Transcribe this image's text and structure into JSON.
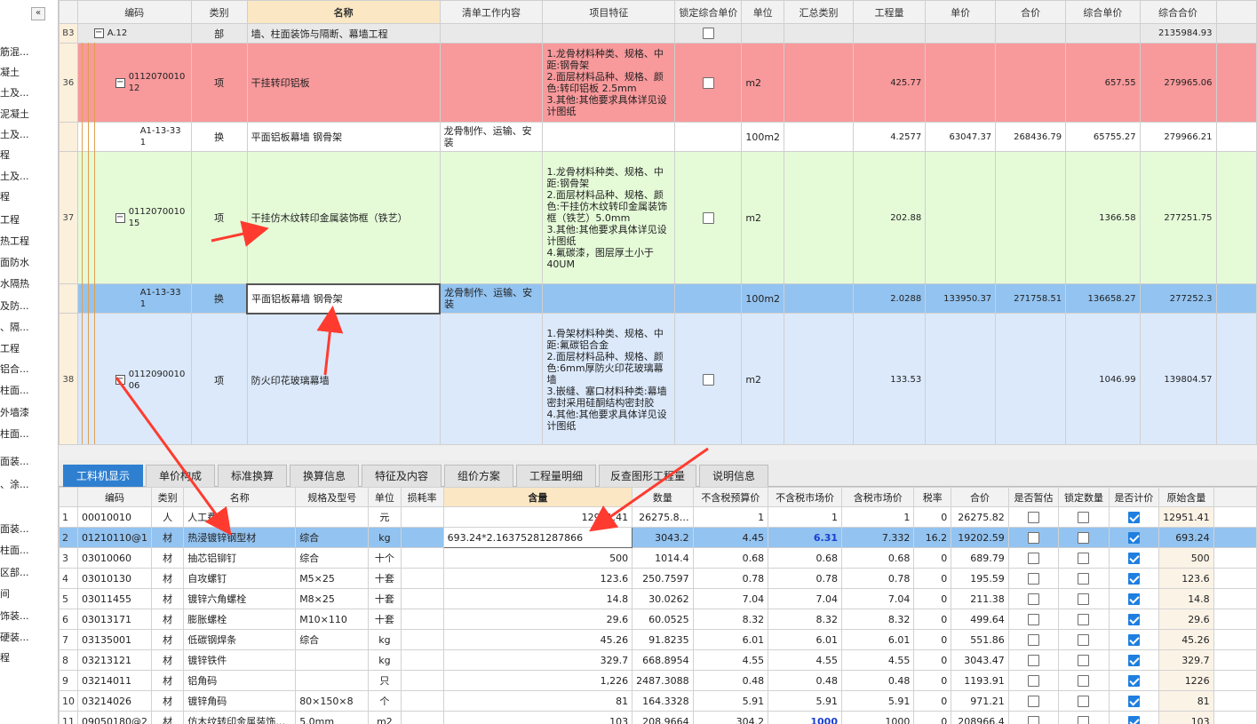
{
  "sidebar": {
    "collapse_label": "«",
    "items": [
      "筋混...",
      "凝土",
      "土及...",
      "泥凝土",
      "土及...",
      "程",
      "土及...",
      "程",
      "工程",
      "热工程",
      "面防水",
      "水隔热",
      "及防...",
      "、隔...",
      "工程",
      "铝合...",
      "柱面...",
      "外墙漆",
      "柱面...",
      "",
      "面装...",
      "、涂...",
      "",
      "面装...",
      "柱面...",
      "区部...",
      "间",
      "饰装...",
      "硬装...",
      "程"
    ]
  },
  "upper": {
    "headers": [
      "编码",
      "类别",
      "名称",
      "清单工作内容",
      "项目特征",
      "锁定综合单价",
      "单位",
      "汇总类别",
      "工程量",
      "单价",
      "合价",
      "综合单价",
      "综合合价"
    ],
    "rows": [
      {
        "idx": "B3",
        "code": "A.12",
        "type": "部",
        "name": "墙、柱面装饰与隔断、幕墙工程",
        "work": "",
        "feature": "",
        "unit": "",
        "qty": "",
        "price": "",
        "total": "",
        "uprice": "",
        "utotal": "2135984.93"
      },
      {
        "idx": "36",
        "code": "011207001012",
        "type": "项",
        "name": "干挂转印铝板",
        "work": "",
        "feature": "1.龙骨材料种类、规格、中距:钢骨架\n2.面层材料品种、规格、颜色:转印铝板 2.5mm\n3.其他:其他要求具体详见设计图纸",
        "unit": "m2",
        "qty": "425.77",
        "price": "",
        "total": "",
        "uprice": "657.55",
        "utotal": "279965.06"
      },
      {
        "idx": "",
        "code": "A1-13-331",
        "type": "换",
        "name": "平面铝板幕墙 钢骨架",
        "work": "龙骨制作、运输、安装",
        "feature": "",
        "unit": "100m2",
        "qty": "4.2577",
        "price": "63047.37",
        "total": "268436.79",
        "uprice": "65755.27",
        "utotal": "279966.21"
      },
      {
        "idx": "37",
        "code": "011207001015",
        "type": "项",
        "name": "干挂仿木纹转印金属装饰框（铁艺）",
        "work": "",
        "feature": "1.龙骨材料种类、规格、中距:钢骨架\n2.面层材料品种、规格、颜色:干挂仿木纹转印金属装饰框（铁艺）5.0mm\n3.其他:其他要求具体详见设计图纸\n4.氟碳漆，图层厚土小于40UM",
        "unit": "m2",
        "qty": "202.88",
        "price": "",
        "total": "",
        "uprice": "1366.58",
        "utotal": "277251.75"
      },
      {
        "idx": "",
        "code": "A1-13-331",
        "type": "换",
        "name": "平面铝板幕墙 钢骨架",
        "work": "龙骨制作、运输、安装",
        "feature": "",
        "unit": "100m2",
        "qty": "2.0288",
        "price": "133950.37",
        "total": "271758.51",
        "uprice": "136658.27",
        "utotal": "277252.3"
      },
      {
        "idx": "38",
        "code": "011209001006",
        "type": "项",
        "name": "防火印花玻璃幕墙",
        "work": "",
        "feature": "1.骨架材料种类、规格、中距:氟碳铝合金\n2.面层材料品种、规格、颜色:6mm厚防火印花玻璃幕墙\n3.嵌缝、塞口材料种类:幕墙密封采用硅酮结构密封胶\n4.其他:其他要求具体详见设计图纸",
        "unit": "m2",
        "qty": "133.53",
        "price": "",
        "total": "",
        "uprice": "1046.99",
        "utotal": "139804.57"
      }
    ]
  },
  "tabs": [
    "工料机显示",
    "单价构成",
    "标准换算",
    "换算信息",
    "特征及内容",
    "组价方案",
    "工程量明细",
    "反查图形工程量",
    "说明信息"
  ],
  "lower": {
    "headers": [
      "",
      "编码",
      "类别",
      "名称",
      "规格及型号",
      "单位",
      "损耗率",
      "含量",
      "数量",
      "不含税预算价",
      "不含税市场价",
      "含税市场价",
      "税率",
      "合价",
      "是否暂估",
      "锁定数量",
      "是否计价",
      "原始含量"
    ],
    "rows": [
      {
        "n": "1",
        "code": "00010010",
        "type": "人",
        "name": "人工费",
        "spec": "",
        "unit": "元",
        "loss": "",
        "amount": "12951.41",
        "qty": "26275.8…",
        "budget": "1",
        "market": "1",
        "taxm": "1",
        "rate": "0",
        "sum": "26275.82",
        "est": false,
        "lock": false,
        "calc": true,
        "orig": "12951.41"
      },
      {
        "n": "2",
        "code": "01210110@1",
        "type": "材",
        "name": "热浸镀锌钢型材",
        "spec": "综合",
        "unit": "kg",
        "loss": "",
        "amount": "693.24*2.16375281287866",
        "qty": "3043.2",
        "budget": "4.45",
        "market": "6.31",
        "taxm": "7.332",
        "rate": "16.2",
        "sum": "19202.59",
        "est": false,
        "lock": false,
        "calc": true,
        "orig": "693.24"
      },
      {
        "n": "3",
        "code": "03010060",
        "type": "材",
        "name": "抽芯铝铆钉",
        "spec": "综合",
        "unit": "十个",
        "loss": "",
        "amount": "500",
        "qty": "1014.4",
        "budget": "0.68",
        "market": "0.68",
        "taxm": "0.68",
        "rate": "0",
        "sum": "689.79",
        "est": false,
        "lock": false,
        "calc": true,
        "orig": "500"
      },
      {
        "n": "4",
        "code": "03010130",
        "type": "材",
        "name": "自攻螺钉",
        "spec": "M5×25",
        "unit": "十套",
        "loss": "",
        "amount": "123.6",
        "qty": "250.7597",
        "budget": "0.78",
        "market": "0.78",
        "taxm": "0.78",
        "rate": "0",
        "sum": "195.59",
        "est": false,
        "lock": false,
        "calc": true,
        "orig": "123.6"
      },
      {
        "n": "5",
        "code": "03011455",
        "type": "材",
        "name": "镀锌六角螺栓",
        "spec": "M8×25",
        "unit": "十套",
        "loss": "",
        "amount": "14.8",
        "qty": "30.0262",
        "budget": "7.04",
        "market": "7.04",
        "taxm": "7.04",
        "rate": "0",
        "sum": "211.38",
        "est": false,
        "lock": false,
        "calc": true,
        "orig": "14.8"
      },
      {
        "n": "6",
        "code": "03013171",
        "type": "材",
        "name": "膨胀螺栓",
        "spec": "M10×110",
        "unit": "十套",
        "loss": "",
        "amount": "29.6",
        "qty": "60.0525",
        "budget": "8.32",
        "market": "8.32",
        "taxm": "8.32",
        "rate": "0",
        "sum": "499.64",
        "est": false,
        "lock": false,
        "calc": true,
        "orig": "29.6"
      },
      {
        "n": "7",
        "code": "03135001",
        "type": "材",
        "name": "低碳钢焊条",
        "spec": "综合",
        "unit": "kg",
        "loss": "",
        "amount": "45.26",
        "qty": "91.8235",
        "budget": "6.01",
        "market": "6.01",
        "taxm": "6.01",
        "rate": "0",
        "sum": "551.86",
        "est": false,
        "lock": false,
        "calc": true,
        "orig": "45.26"
      },
      {
        "n": "8",
        "code": "03213121",
        "type": "材",
        "name": "镀锌铁件",
        "spec": "",
        "unit": "kg",
        "loss": "",
        "amount": "329.7",
        "qty": "668.8954",
        "budget": "4.55",
        "market": "4.55",
        "taxm": "4.55",
        "rate": "0",
        "sum": "3043.47",
        "est": false,
        "lock": false,
        "calc": true,
        "orig": "329.7"
      },
      {
        "n": "9",
        "code": "03214011",
        "type": "材",
        "name": "铝角码",
        "spec": "",
        "unit": "只",
        "loss": "",
        "amount": "1,226",
        "qty": "2487.3088",
        "budget": "0.48",
        "market": "0.48",
        "taxm": "0.48",
        "rate": "0",
        "sum": "1193.91",
        "est": false,
        "lock": false,
        "calc": true,
        "orig": "1226"
      },
      {
        "n": "10",
        "code": "03214026",
        "type": "材",
        "name": "镀锌角码",
        "spec": "80×150×8",
        "unit": "个",
        "loss": "",
        "amount": "81",
        "qty": "164.3328",
        "budget": "5.91",
        "market": "5.91",
        "taxm": "5.91",
        "rate": "0",
        "sum": "971.21",
        "est": false,
        "lock": false,
        "calc": true,
        "orig": "81"
      },
      {
        "n": "11",
        "code": "09050180@2",
        "type": "材",
        "name": "仿木纹转印金属装饰…",
        "spec": "5.0mm",
        "unit": "m2",
        "loss": "",
        "amount": "103",
        "qty": "208.9664",
        "budget": "304.2",
        "market": "1000",
        "taxm": "1000",
        "rate": "0",
        "sum": "208966.4",
        "est": false,
        "lock": false,
        "calc": true,
        "orig": "103"
      }
    ]
  },
  "colors": {
    "accent": "#2f7fd0",
    "selected_row": "#93c3f0",
    "arrow": "#ff3b2f",
    "red_row": "#f8999b",
    "green_row": "#e5fbd8",
    "blue_row": "#dbe9fb"
  }
}
